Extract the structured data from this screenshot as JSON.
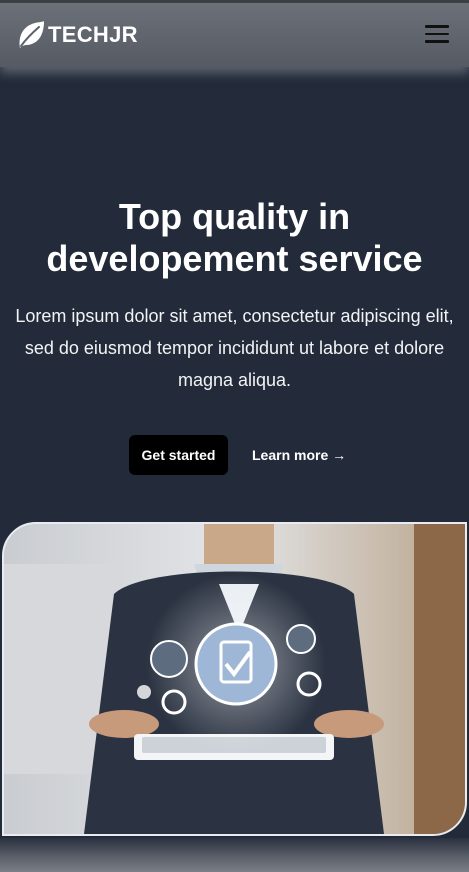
{
  "brand": {
    "name": "TECHJR",
    "logo_icon": "leaf-icon"
  },
  "nav": {
    "menu_icon": "hamburger-menu-icon"
  },
  "hero": {
    "title": "Top quality in developement service",
    "description": "Lorem ipsum dolor sit amet, consectetur adipiscing elit, sed do eiusmod tempor incididunt ut labore et dolore magna aliqua.",
    "primary_button": "Get started",
    "secondary_link": "Learn more →"
  },
  "colors": {
    "background": "#232b3a",
    "navbar": "#60656e",
    "primary_button": "#000000",
    "text": "#ffffff"
  }
}
